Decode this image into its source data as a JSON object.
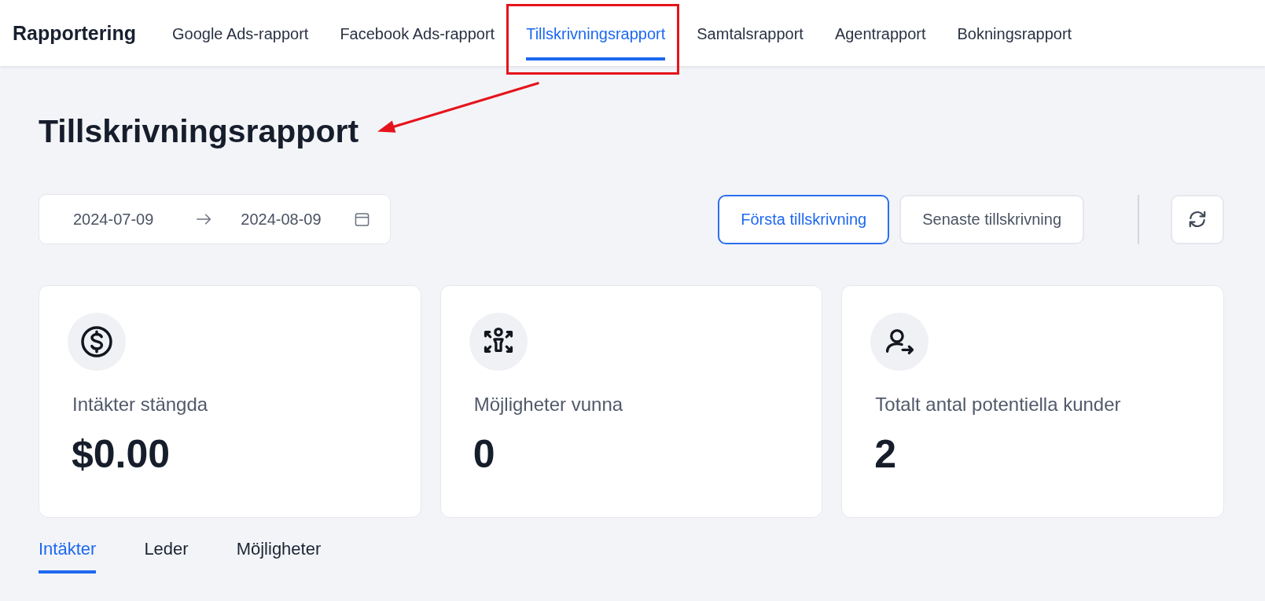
{
  "header": {
    "title": "Rapportering",
    "nav": [
      {
        "label": "Google Ads-rapport",
        "selected": false,
        "highlighted": false
      },
      {
        "label": "Facebook Ads-rapport",
        "selected": false,
        "highlighted": false
      },
      {
        "label": "Tillskrivningsrapport",
        "selected": true,
        "highlighted": true
      },
      {
        "label": "Samtalsrapport",
        "selected": false,
        "highlighted": false
      },
      {
        "label": "Agentrapport",
        "selected": false,
        "highlighted": false
      },
      {
        "label": "Bokningsrapport",
        "selected": false,
        "highlighted": false
      }
    ]
  },
  "page_title": "Tillskrivningsrapport",
  "date_range": {
    "start": "2024-07-09",
    "end": "2024-08-09"
  },
  "attribution": [
    {
      "label": "Första tillskrivning",
      "selected": true
    },
    {
      "label": "Senaste tillskrivning",
      "selected": false
    }
  ],
  "stats": [
    {
      "kind": "revenue",
      "label": "Intäkter stängda",
      "value": "$0.00"
    },
    {
      "kind": "opportunities",
      "label": "Möjligheter vunna",
      "value": "0"
    },
    {
      "kind": "leads",
      "label": "Totalt antal potentiella kunder",
      "value": "2"
    }
  ],
  "tabs": [
    {
      "label": "Intäkter",
      "selected": true
    },
    {
      "label": "Leder",
      "selected": false
    },
    {
      "label": "Möjligheter",
      "selected": false
    }
  ]
}
